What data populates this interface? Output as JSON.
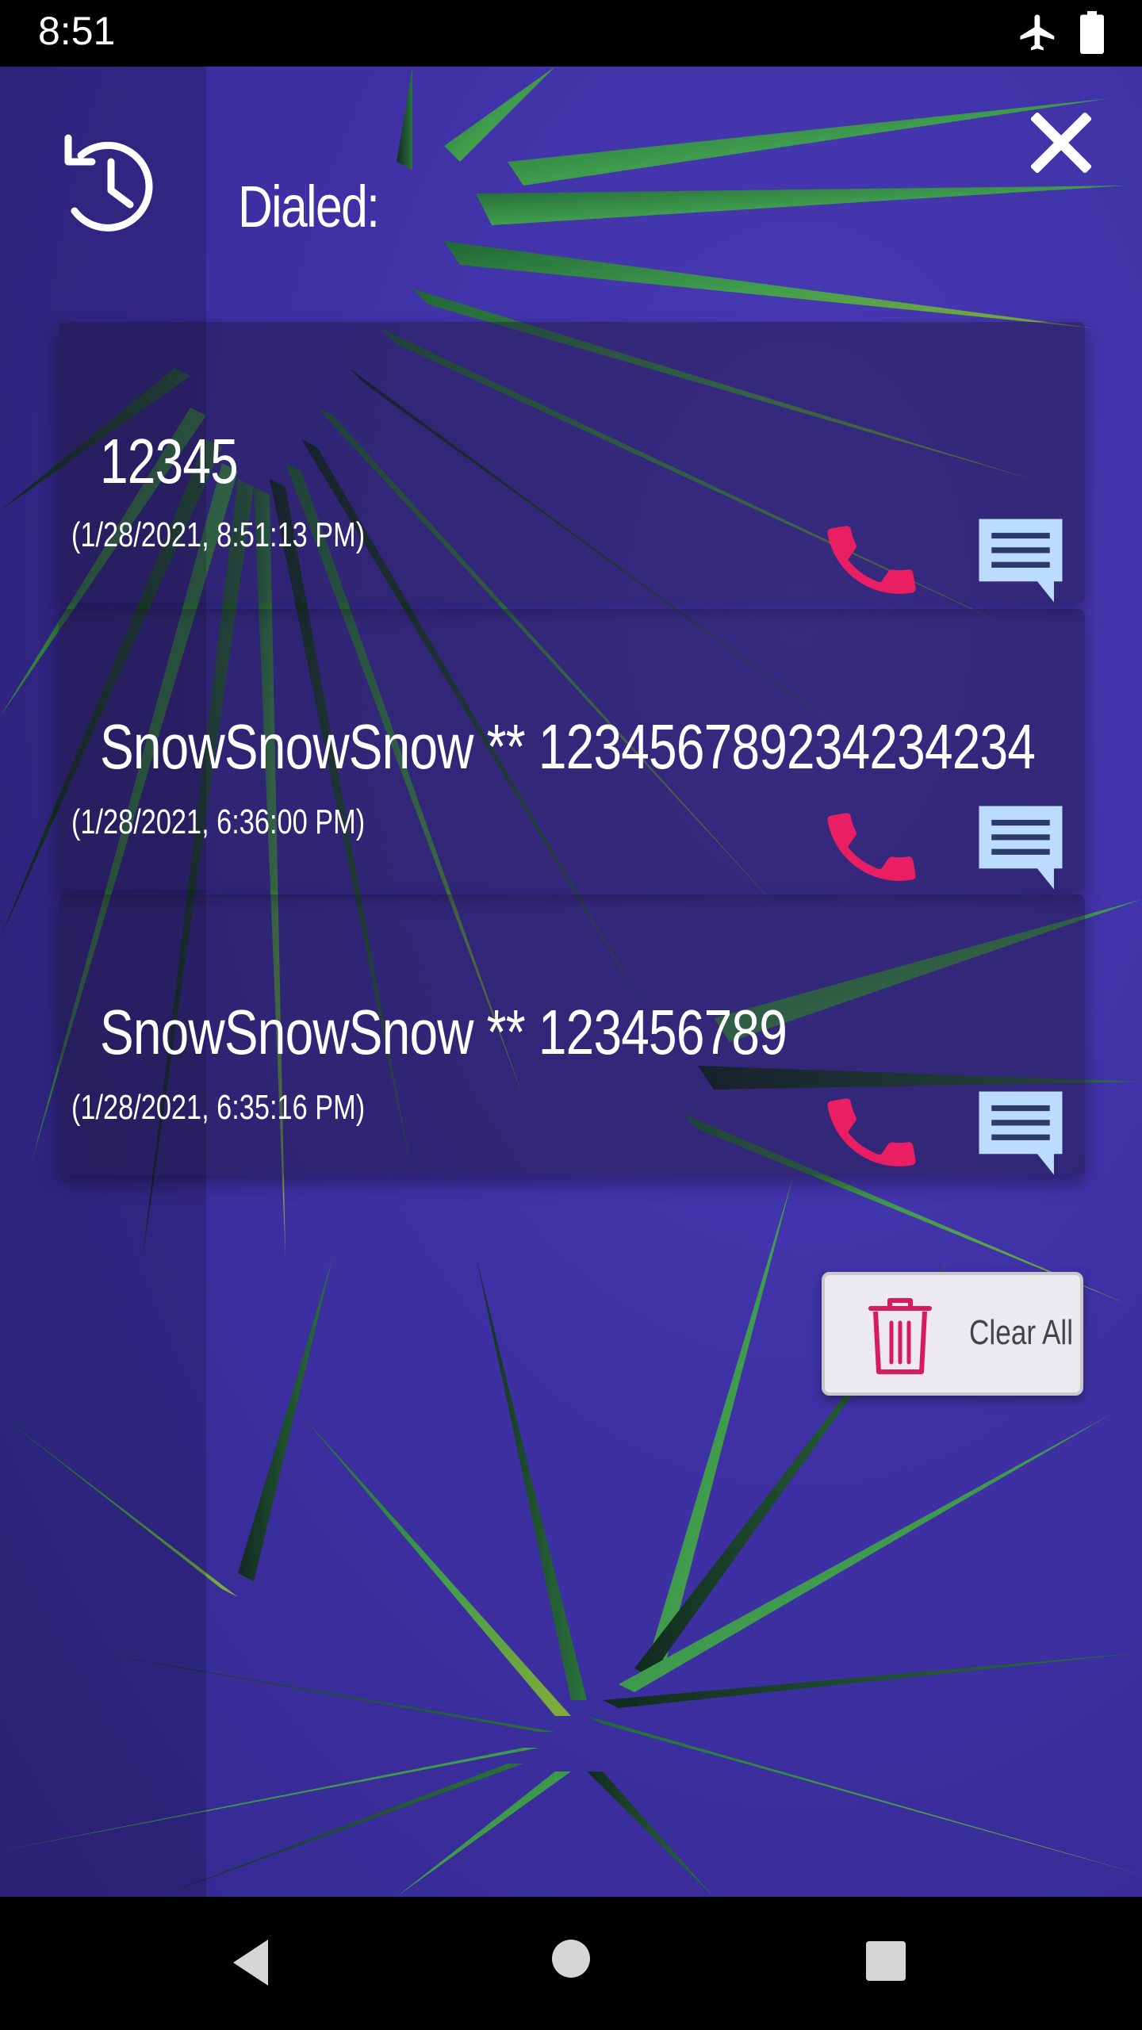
{
  "status_bar": {
    "time": "8:51",
    "icons": [
      "airplane-mode-icon",
      "battery-icon"
    ]
  },
  "header": {
    "title": "Dialed:",
    "icons": [
      "history-icon",
      "close-icon"
    ]
  },
  "calls": [
    {
      "name": "12345",
      "datetime": "(1/28/2021, 8:51:13 PM)"
    },
    {
      "name": "SnowSnowSnow ** 123456789234234234",
      "datetime": "(1/28/2021, 6:36:00 PM)"
    },
    {
      "name": "SnowSnowSnow ** 123456789",
      "datetime": "(1/28/2021, 6:35:16 PM)"
    }
  ],
  "clear_all": {
    "label": "Clear All"
  },
  "colors": {
    "call_icon": "#e91e63",
    "message_icon": "#bcdcff",
    "trash_icon": "#d81b60",
    "background": "#3f31a5",
    "foliage": "#2e8b3a"
  },
  "nav_bar": {
    "icons": [
      "back-icon",
      "home-icon",
      "recents-icon"
    ]
  }
}
